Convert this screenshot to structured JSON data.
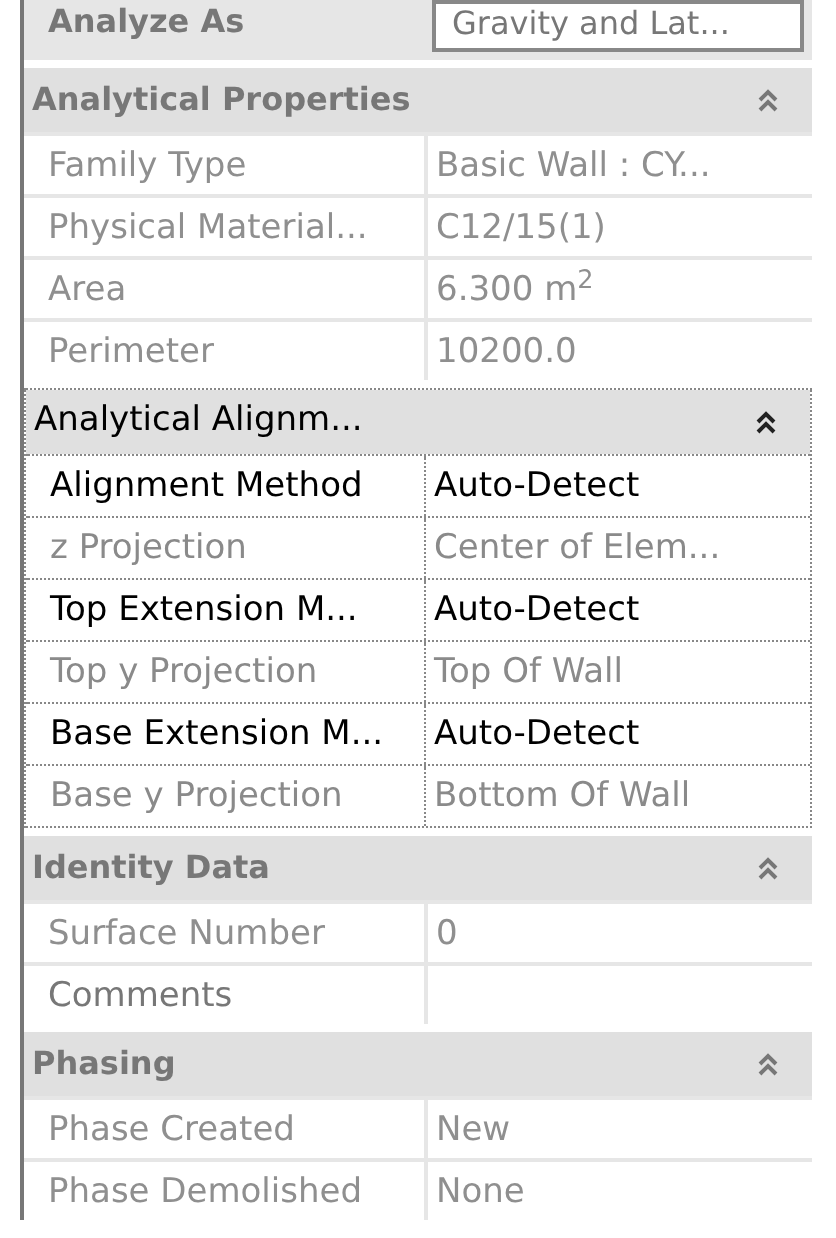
{
  "top_row": {
    "label": "Analyze As",
    "value": "Gravity and Lat..."
  },
  "sections": [
    {
      "title": "Analytical Properties",
      "focused": false,
      "expanded": true,
      "rows": [
        {
          "label": "Family Type",
          "value": "Basic Wall : CY...",
          "disabled": true
        },
        {
          "label": "Physical Material...",
          "value": "C12/15(1)",
          "disabled": true
        },
        {
          "label": "Area",
          "value": "6.300 m$^{2}$",
          "disabled": true
        },
        {
          "label": "Perimeter",
          "value": "10200.0",
          "disabled": true
        }
      ]
    },
    {
      "title": "Analytical Alignm...",
      "focused": true,
      "expanded": true,
      "rows": [
        {
          "label": "Alignment Method",
          "value": "Auto-Detect",
          "disabled": false
        },
        {
          "label": "z Projection",
          "value": "Center of Elem...",
          "disabled": true
        },
        {
          "label": "Top Extension M...",
          "value": "Auto-Detect",
          "disabled": false
        },
        {
          "label": "Top y Projection",
          "value": "Top Of Wall",
          "disabled": true
        },
        {
          "label": "Base Extension M...",
          "value": "Auto-Detect",
          "disabled": false
        },
        {
          "label": "Base y Projection",
          "value": "Bottom Of Wall",
          "disabled": true
        }
      ]
    },
    {
      "title": "Identity Data",
      "focused": false,
      "expanded": true,
      "rows": [
        {
          "label": "Surface Number",
          "value": "0",
          "disabled": true
        },
        {
          "label": "Comments",
          "value": "",
          "disabled": false
        }
      ]
    },
    {
      "title": "Phasing",
      "focused": false,
      "expanded": true,
      "rows": [
        {
          "label": "Phase Created",
          "value": "New",
          "disabled": true
        },
        {
          "label": "Phase Demolished",
          "value": "None",
          "disabled": true
        }
      ]
    }
  ]
}
